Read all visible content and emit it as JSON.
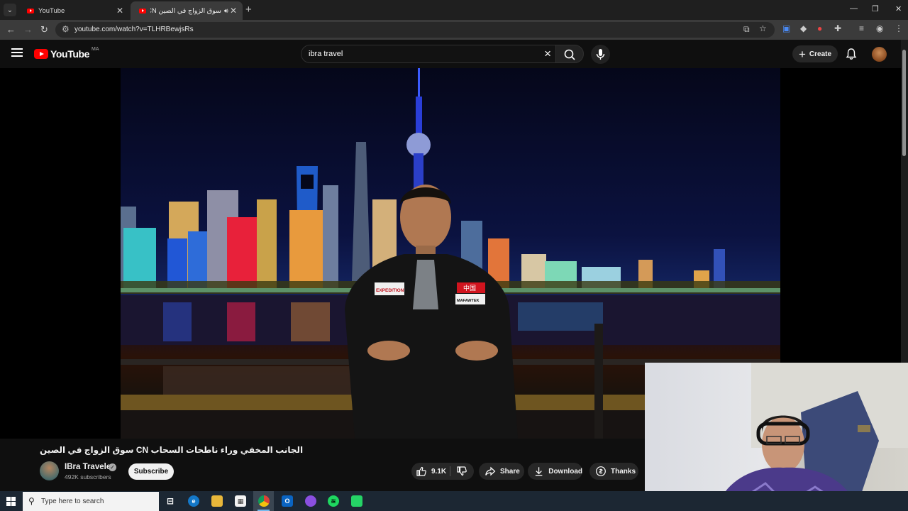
{
  "browser": {
    "tabs": [
      {
        "label": "YouTube",
        "active": false
      },
      {
        "label": "سوق الزواج في الصين CN ال...",
        "active": true
      }
    ],
    "new_tab_icon": "plus-icon",
    "url": "youtube.com/watch?v=TLHRBewjsRs"
  },
  "youtube": {
    "logo_text": "YouTube",
    "country_code": "MA",
    "search_value": "ibra travel",
    "create_label": "Create"
  },
  "video": {
    "title": "الجانب المخفي وراء ناطحات السحاب CN سوق الزواج في الصين",
    "channel_name": "IBra Traveler",
    "subscribers": "492K subscribers",
    "subscribe_label": "Subscribe",
    "likes": "9.1K",
    "share_label": "Share",
    "download_label": "Download",
    "thanks_label": "Thanks",
    "scene_text": {
      "badge_left": "EXPEDITION",
      "badge_right_top": "中国",
      "badge_right_bottom": "MAFAWTEK"
    }
  },
  "taskbar": {
    "search_placeholder": "Type here to search",
    "apps": [
      "task-view",
      "edge",
      "file-explorer",
      "store",
      "chrome",
      "outlook",
      "messenger",
      "spotify",
      "whatsapp"
    ]
  },
  "colors": {
    "youtube_red": "#ff0000",
    "background": "#0f0f0f",
    "pill": "#272727",
    "taskbar": "#1c2733"
  }
}
